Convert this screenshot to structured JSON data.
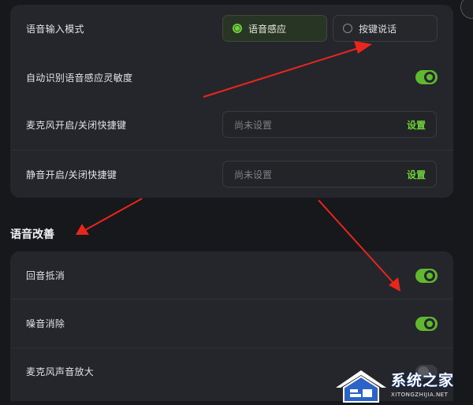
{
  "voice_settings": {
    "input_mode": {
      "label": "语音输入模式",
      "options": [
        {
          "label": "语音感应",
          "selected": true
        },
        {
          "label": "按键说话",
          "selected": false
        }
      ]
    },
    "auto_sensitivity": {
      "label": "自动识别语音感应灵敏度",
      "enabled": true
    },
    "mic_hotkey": {
      "label": "麦克风开启/关闭快捷键",
      "placeholder": "尚未设置",
      "action": "设置"
    },
    "mute_hotkey": {
      "label": "静音开启/关闭快捷键",
      "placeholder": "尚未设置",
      "action": "设置"
    }
  },
  "voice_improvement": {
    "title": "语音改善",
    "echo_cancel": {
      "label": "回音抵消",
      "enabled": true
    },
    "noise_cancel": {
      "label": "噪音消除",
      "enabled": true
    },
    "mic_boost": {
      "label": "麦克风声音放大",
      "enabled": false
    }
  },
  "watermark": {
    "main": "系统之家",
    "sub": "XITONGZHIJIA.NET"
  },
  "colors": {
    "accent": "#6fd13a",
    "card": "#24262b",
    "background": "#17181b",
    "arrow": "#e8261c"
  }
}
